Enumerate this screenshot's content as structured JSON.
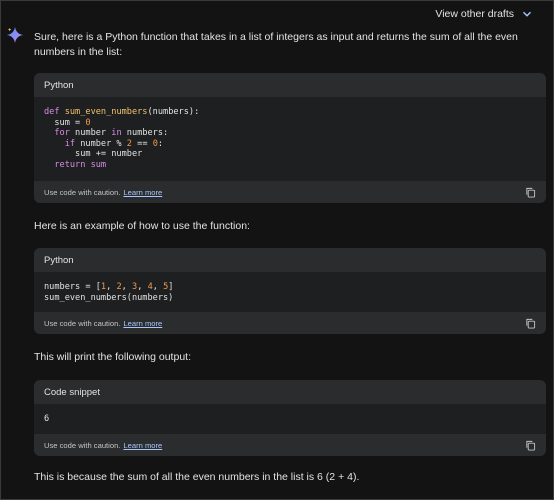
{
  "header": {
    "view_drafts": "View other drafts"
  },
  "response": {
    "intro": "Sure, here is a Python function that takes in a list of integers as input and returns the sum of all the even numbers in the list:",
    "example_text": "Here is an example of how to use the function:",
    "output_text": "This will print the following output:",
    "conclusion": "This is because the sum of all the even numbers in the list is 6 (2 + 4)."
  },
  "code_blocks": [
    {
      "language": "Python",
      "lines": [
        [
          "def ",
          "sum_even_numbers",
          "(numbers):"
        ],
        [
          "  sum = ",
          "0"
        ],
        [
          "  for ",
          "number ",
          "in ",
          "numbers:"
        ],
        [
          "    if ",
          "number % ",
          "2",
          " == ",
          "0",
          ":"
        ],
        [
          "      sum += number"
        ],
        [
          "  return ",
          "sum"
        ]
      ],
      "footer": "Use code with caution.",
      "learn_more": "Learn more"
    },
    {
      "language": "Python",
      "lines": [
        [
          "numbers = [",
          "1",
          ", ",
          "2",
          ", ",
          "3",
          ", ",
          "4",
          ", ",
          "5",
          "]"
        ],
        [
          "sum_even_numbers(numbers)"
        ]
      ],
      "footer": "Use code with caution.",
      "learn_more": "Learn more"
    },
    {
      "language": "Code snippet",
      "lines": [
        [
          "6"
        ]
      ],
      "footer": "Use code with caution.",
      "learn_more": "Learn more"
    }
  ],
  "icons": {
    "spark": "gemini-spark-icon",
    "copy": "copy-icon",
    "chevron": "chevron-down-icon"
  }
}
